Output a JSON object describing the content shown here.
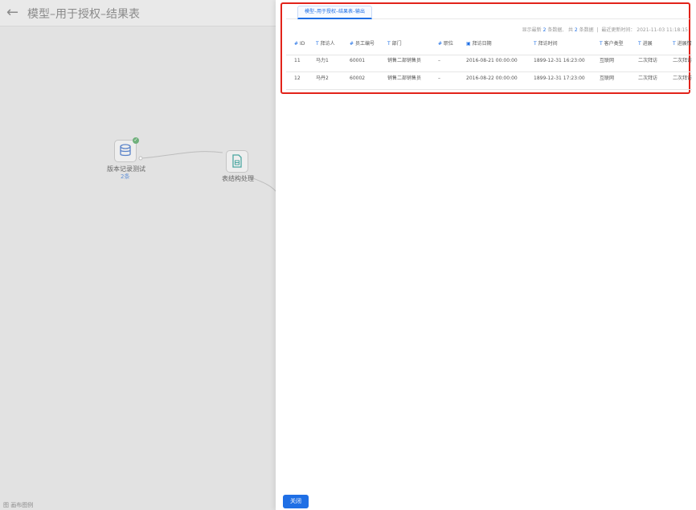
{
  "left": {
    "back_icon": "arrow-left-icon",
    "title": "模型–用于授权–结果表",
    "node1": {
      "label": "版本记录测试",
      "sub": "2条",
      "icon": "database-icon"
    },
    "node2": {
      "label": "表结构处理",
      "icon": "file-table-icon"
    },
    "legend": "图 画布图例"
  },
  "drawer": {
    "tab": "模型–用于授权–结果表–输出",
    "meta": {
      "prefix": "显示最新",
      "shown": "2",
      "shown_suffix": "条数据,",
      "total_prefix": "共",
      "total": "2",
      "total_suffix": "条数据",
      "updated_label": "最近更新时间：",
      "updated": "2021-11-03 11:18:15"
    },
    "columns": [
      {
        "label": "ID",
        "type": "#"
      },
      {
        "label": "拜访人",
        "type": "T"
      },
      {
        "label": "员工编号",
        "type": "#"
      },
      {
        "label": "部门",
        "type": "T"
      },
      {
        "label": "职位",
        "type": "#"
      },
      {
        "label": "拜访日期",
        "type": "cal"
      },
      {
        "label": "拜访时间",
        "type": "T"
      },
      {
        "label": "客户类型",
        "type": "T"
      },
      {
        "label": "进展",
        "type": "T"
      },
      {
        "label": "进展情",
        "type": "T"
      }
    ],
    "rows": [
      [
        "11",
        "马力1",
        "60001",
        "销售二部销售员",
        "–",
        "2016-08-21 00:00:00",
        "1899-12-31 16:23:00",
        "互联网",
        "二次拜访",
        "二次拜访"
      ],
      [
        "12",
        "马丹2",
        "60002",
        "销售二部销售员",
        "–",
        "2016-08-22 00:00:00",
        "1899-12-31 17:23:00",
        "互联网",
        "二次拜访",
        "二次拜访"
      ]
    ],
    "close_label": "关闭"
  }
}
